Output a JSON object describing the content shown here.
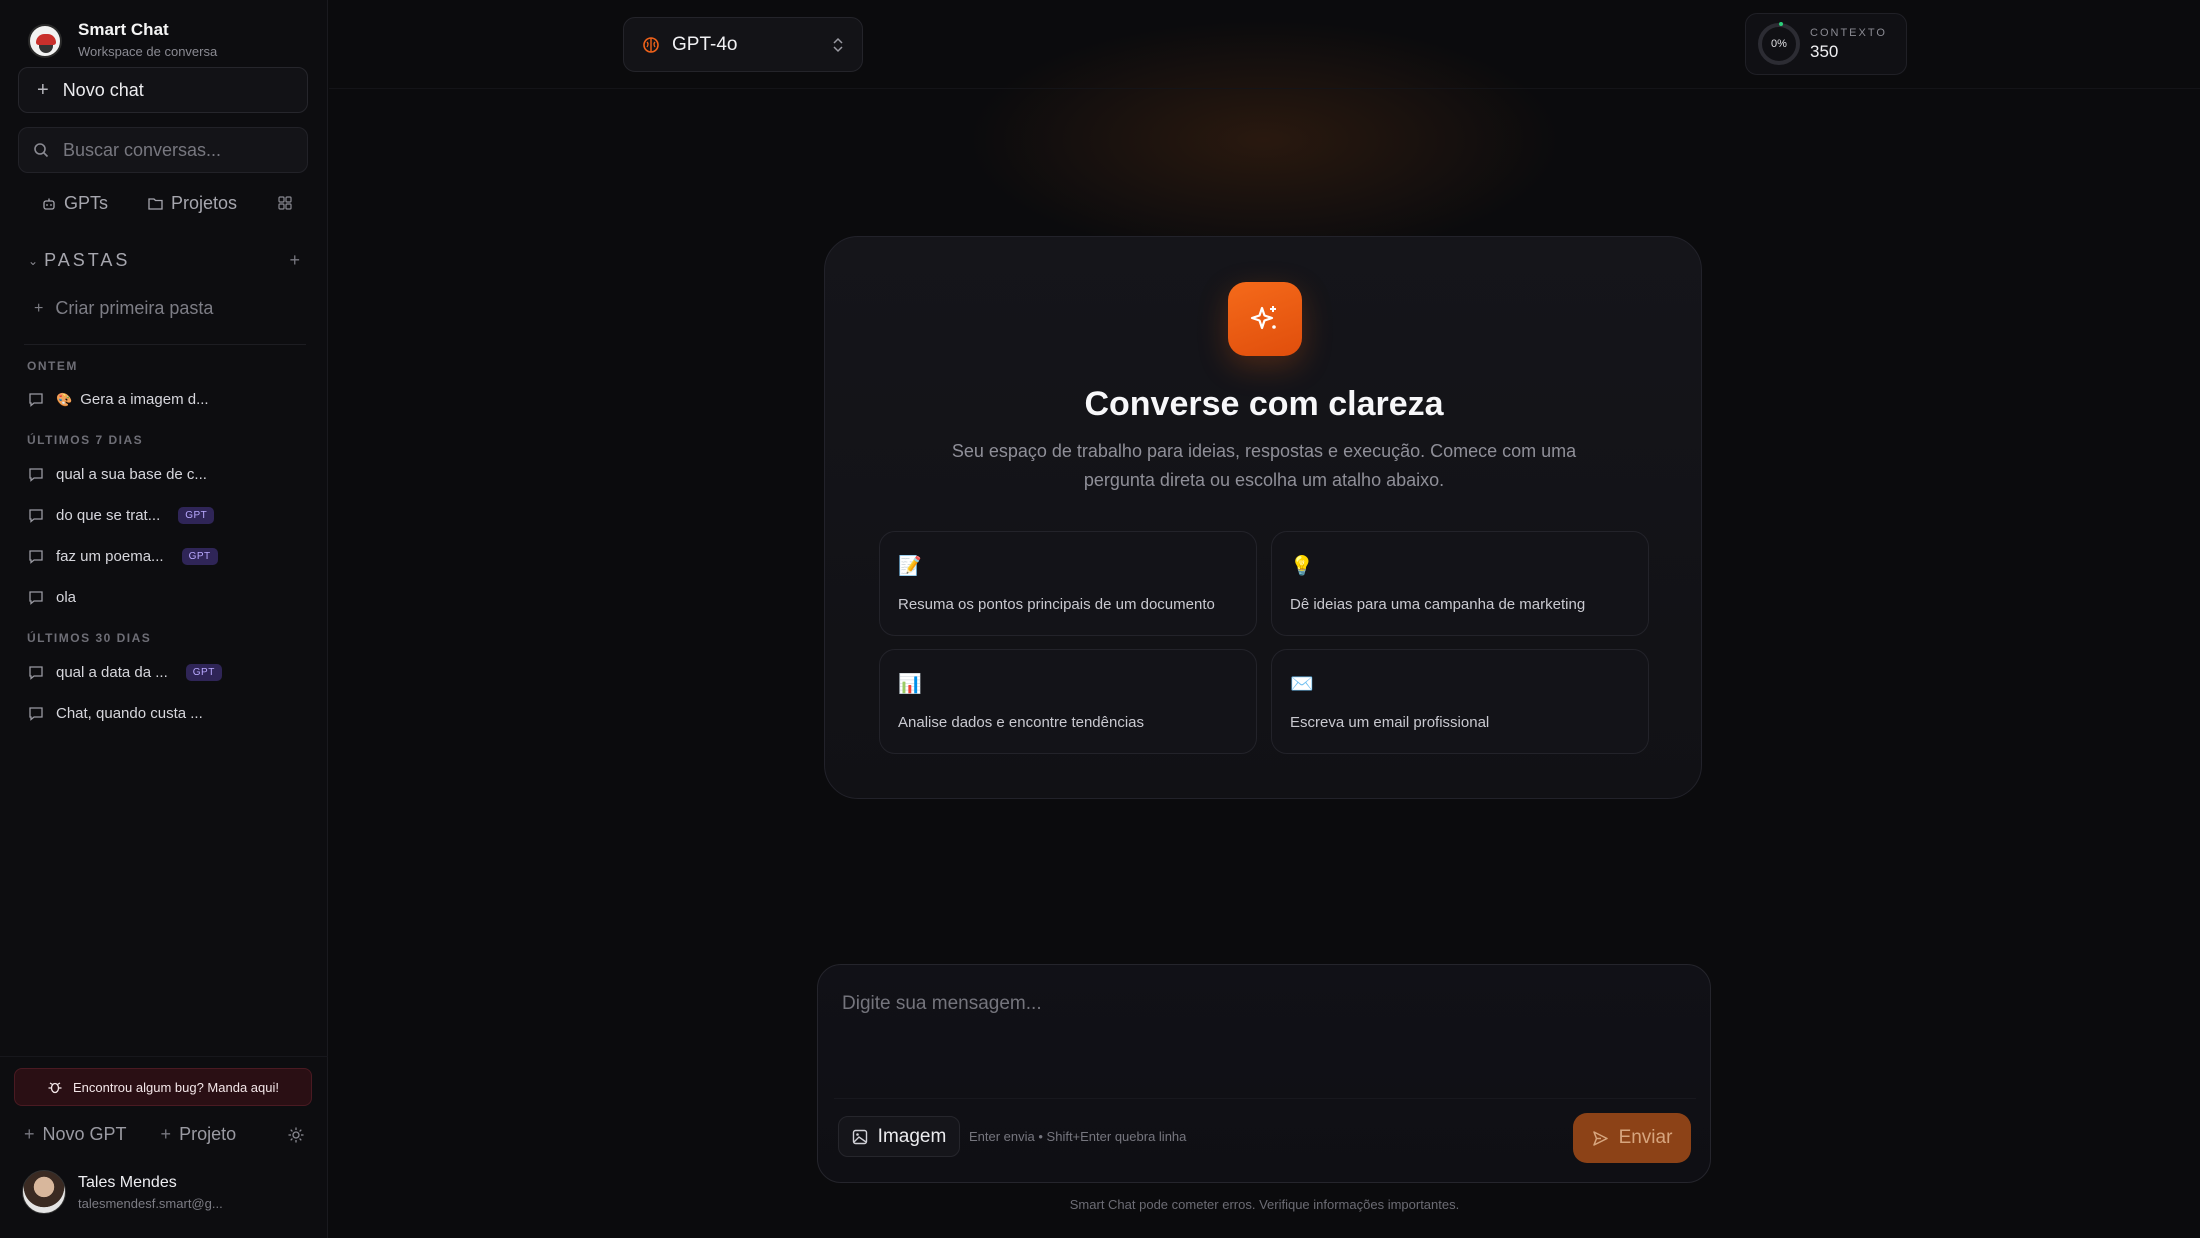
{
  "app": {
    "title": "Smart Chat",
    "subtitle": "Workspace de conversa"
  },
  "sidebar": {
    "new_chat": "Novo chat",
    "search_placeholder": "Buscar conversas...",
    "links": {
      "gpts": "GPTs",
      "projects": "Projetos"
    },
    "folders_label": "PASTAS",
    "create_folder": "Criar primeira pasta",
    "groups": [
      {
        "label": "ONTEM",
        "items": [
          {
            "title": "Gera a imagem d...",
            "emoji": "🎨",
            "badge": ""
          }
        ]
      },
      {
        "label": "ÚLTIMOS 7 DIAS",
        "items": [
          {
            "title": "qual a sua base de c...",
            "badge": ""
          },
          {
            "title": "do que se trat...",
            "badge": "GPT"
          },
          {
            "title": "faz um poema...",
            "badge": "GPT"
          },
          {
            "title": "ola",
            "badge": ""
          }
        ]
      },
      {
        "label": "ÚLTIMOS 30 DIAS",
        "items": [
          {
            "title": "qual a data da ...",
            "badge": "GPT"
          },
          {
            "title": "Chat, quando custa ...",
            "badge": ""
          }
        ]
      }
    ],
    "bug_report": "Encontrou algum bug? Manda aqui!",
    "new_gpt": "Novo GPT",
    "new_project": "Projeto",
    "user": {
      "name": "Tales Mendes",
      "email": "talesmendesf.smart@g..."
    }
  },
  "header": {
    "model": "GPT-4o",
    "context_label": "CONTEXTO",
    "context_percent": "0%",
    "context_value": "350"
  },
  "welcome": {
    "title": "Converse com clareza",
    "subtitle": "Seu espaço de trabalho para ideias, respostas e execução. Comece com uma pergunta direta ou escolha um atalho abaixo.",
    "suggestions": [
      {
        "icon": "📝",
        "text": "Resuma os pontos principais de um documento"
      },
      {
        "icon": "💡",
        "text": "Dê ideias para uma campanha de marketing"
      },
      {
        "icon": "📊",
        "text": "Analise dados e encontre tendências"
      },
      {
        "icon": "✉️",
        "text": "Escreva um email profissional"
      }
    ]
  },
  "composer": {
    "placeholder": "Digite sua mensagem...",
    "image_button": "Imagem",
    "hint": "Enter envia • Shift+Enter quebra linha",
    "send": "Enviar"
  },
  "footer": {
    "disclaimer": "Smart Chat pode cometer erros. Verifique informações importantes."
  },
  "colors": {
    "accent": "#f0621a",
    "badge_bg": "#2f2557",
    "background": "#0b0b0d"
  }
}
